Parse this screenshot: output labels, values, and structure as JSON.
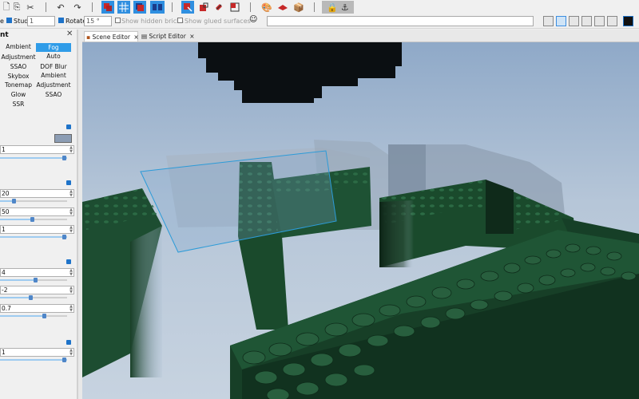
{
  "toolbar2": {
    "label_e": "e",
    "stud_label": "Stud",
    "stud_value": "1",
    "rotate_label": "Rotate",
    "rotate_value": "15 °",
    "show_hidden_label": "Show hidden bricks",
    "show_glued_label": "Show glued surfaces"
  },
  "panel": {
    "title": "nt",
    "categories": [
      {
        "label": "Ambient",
        "selected": false
      },
      {
        "label": "Fog",
        "selected": true
      },
      {
        "label": "Adjustment",
        "selected": false
      },
      {
        "label": "Auto",
        "selected": false
      },
      {
        "label": "SSAO",
        "selected": false
      },
      {
        "label": "DOF Blur",
        "selected": false
      },
      {
        "label": "Skybox",
        "selected": false
      },
      {
        "label": "Ambient",
        "selected": false
      },
      {
        "label": "Tonemap",
        "selected": false
      },
      {
        "label": "Adjustment",
        "selected": false
      },
      {
        "label": "Glow",
        "selected": false
      },
      {
        "label": "SSAO",
        "selected": false
      },
      {
        "label": "SSR",
        "selected": false
      }
    ],
    "fields": {
      "f1": "1",
      "f2": "20",
      "f3": "50",
      "f4": "1",
      "f5": "4",
      "f6": "-2",
      "f7": "0.7",
      "f8": "1"
    }
  },
  "tabs": {
    "scene": "Scene Editor",
    "script": "Script Editor"
  },
  "colors": {
    "accent": "#2f8fe0",
    "brick_green": "#1a4a2c",
    "sky": "#a9bfd6"
  }
}
